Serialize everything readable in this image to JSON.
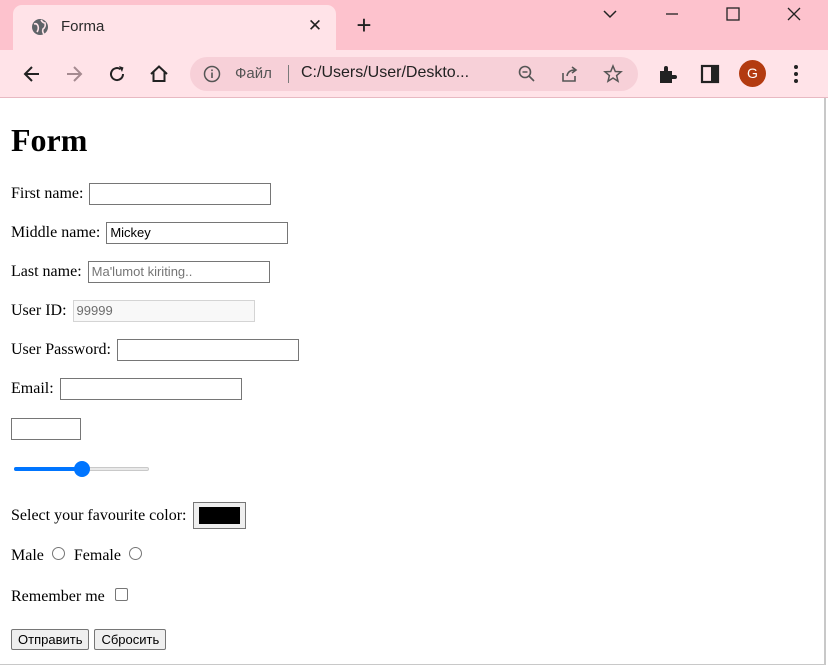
{
  "browser": {
    "tab_title": "Forma",
    "tab_close_glyph": "✕",
    "new_tab_glyph": "+",
    "url_scheme": "Файл",
    "url": "C:/Users/User/Deskto...",
    "profile_initial": "G",
    "accent_color": "#fdc2cd",
    "profile_color": "#b33b10",
    "icons": [
      "globe-icon",
      "chevron-down-icon",
      "minimize-icon",
      "maximize-icon",
      "close-icon",
      "back-arrow-icon",
      "forward-arrow-icon",
      "reload-icon",
      "home-icon",
      "info-icon",
      "zoom-out-icon",
      "share-icon",
      "star-icon",
      "extensions-icon",
      "side-panel-icon",
      "kebab-menu-icon"
    ]
  },
  "page": {
    "title": "Form",
    "first_name": {
      "label": "First name:",
      "value": ""
    },
    "middle_name": {
      "label": "Middle name:",
      "value": "Mickey"
    },
    "last_name": {
      "label": "Last name:",
      "placeholder": "Ma'lumot kiriting.."
    },
    "user_id": {
      "label": "User ID:",
      "value": "99999"
    },
    "password": {
      "label": "User Password:",
      "value": ""
    },
    "email": {
      "label": "Email:",
      "value": ""
    },
    "number_value": "",
    "range_value_fraction": 0.5,
    "color": {
      "label": "Select your favourite color:",
      "value": "#000000"
    },
    "gender": {
      "male_label": "Male",
      "female_label": "Female"
    },
    "remember": {
      "label": "Remember me"
    },
    "submit_label": "Отправить",
    "reset_label": "Сбросить"
  }
}
